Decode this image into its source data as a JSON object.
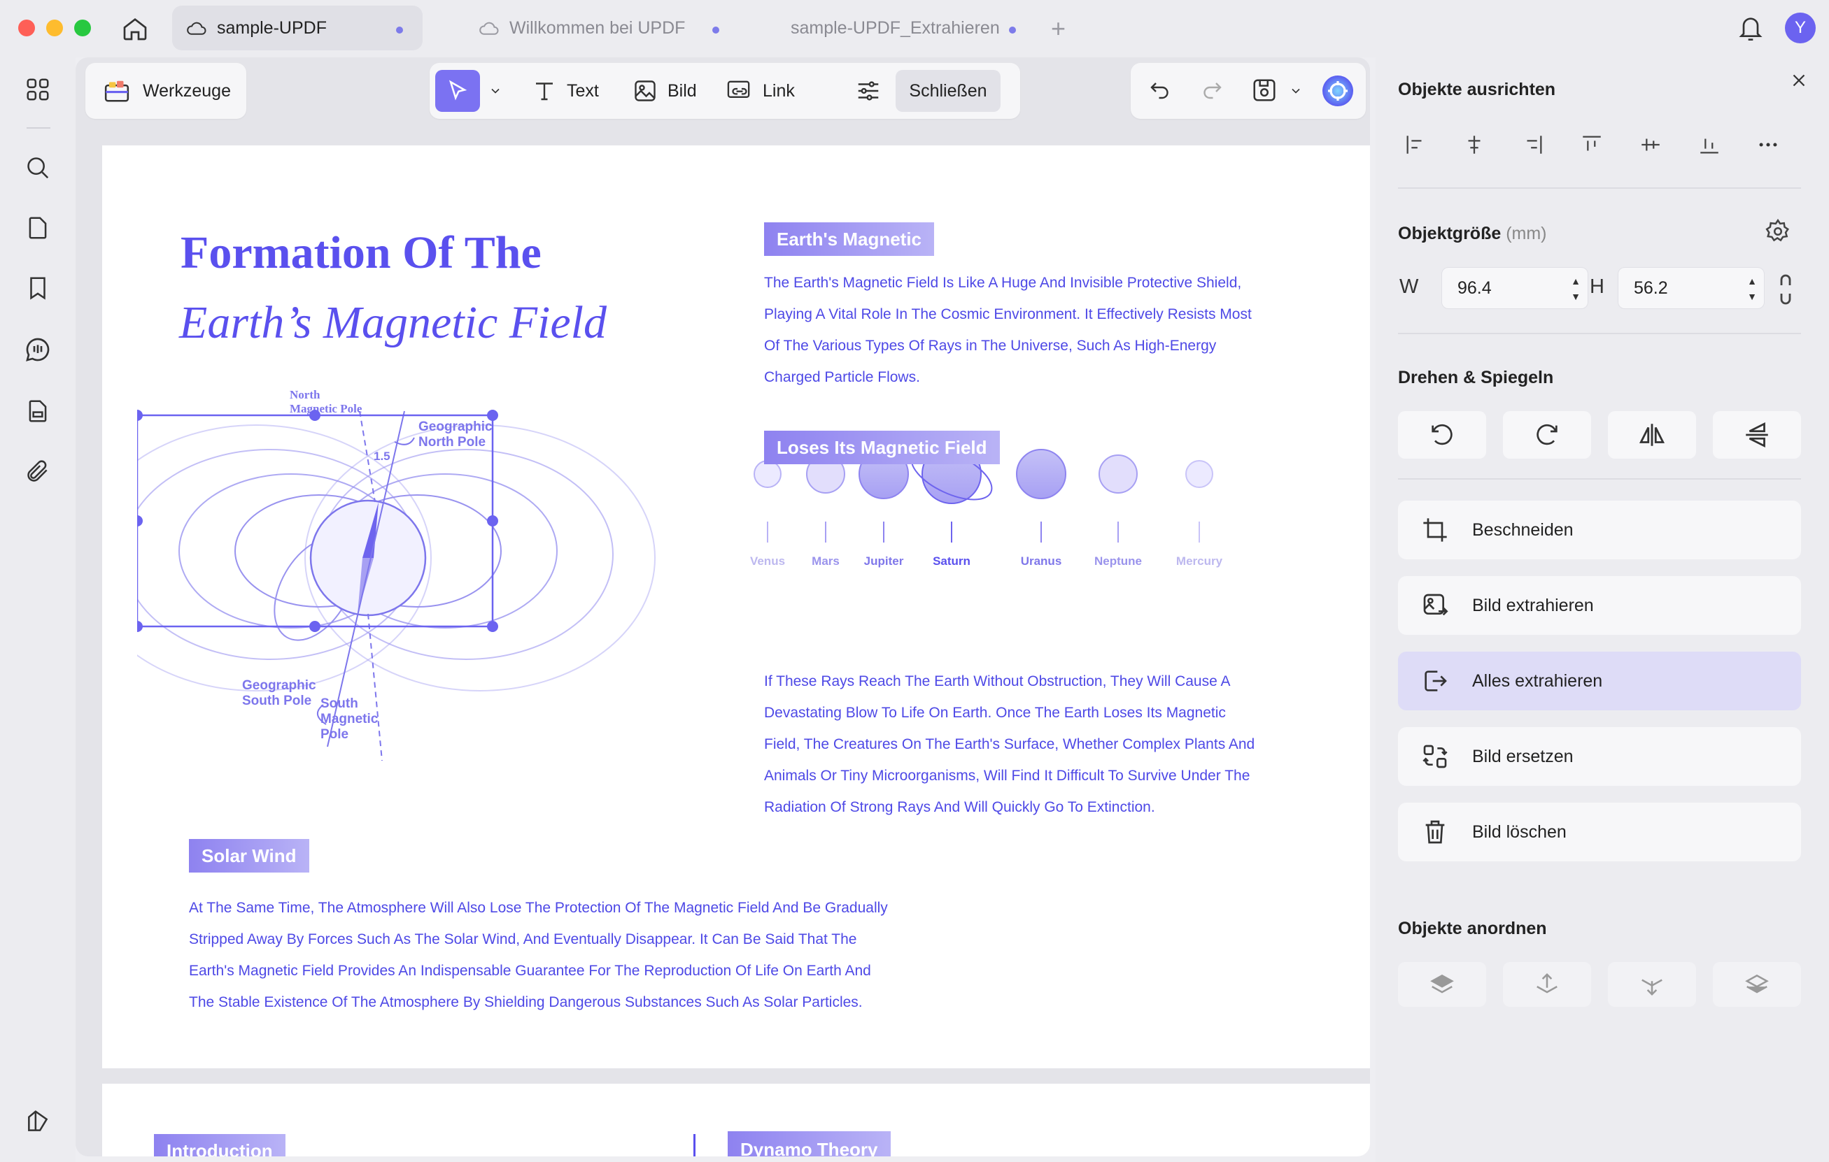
{
  "tabs": [
    {
      "label": "sample-UPDF",
      "active": true
    },
    {
      "label": "Willkommen bei UPDF",
      "active": false
    },
    {
      "label": "sample-UPDF_Extrahieren",
      "active": false
    }
  ],
  "user": {
    "avatar_letter": "Y"
  },
  "toolbar": {
    "tools_label": "Werkzeuge",
    "text_label": "Text",
    "image_label": "Bild",
    "link_label": "Link",
    "close_label": "Schließen"
  },
  "document": {
    "title_line1": "Formation Of The",
    "title_line2": "Earth’s Magnetic Field",
    "section1": {
      "heading": "Earth's Magnetic",
      "lines": [
        "The Earth's Magnetic Field Is Like A Huge And Invisible Protective Shield,",
        "Playing A Vital Role In The Cosmic Environment. It Effectively Resists Most",
        "Of The Various Types Of Rays in The Universe, Such As High-Energy",
        "Charged Particle Flows."
      ]
    },
    "planets": [
      "Venus",
      "Mars",
      "Jupiter",
      "Saturn",
      "Uranus",
      "Neptune",
      "Mercury"
    ],
    "figure_labels": {
      "north_magnetic_pole_1": "North",
      "north_magnetic_pole_2": "Magnetic Pole",
      "geographic_north_1": "Geographic",
      "geographic_north_2": "North Pole",
      "tilt": "1.5",
      "geographic_south_1": "Geographic",
      "geographic_south_2": "South Pole",
      "south_magnetic_1": "South",
      "south_magnetic_2": "Magnetic",
      "south_magnetic_3": "Pole"
    },
    "section2": {
      "heading": "Loses Its Magnetic Field",
      "lines": [
        "If These Rays Reach The Earth Without Obstruction, They Will Cause A",
        "Devastating Blow To Life On Earth. Once The Earth Loses Its Magnetic",
        "Field, The Creatures On The Earth's Surface, Whether Complex Plants And",
        "Animals Or Tiny Microorganisms, Will Find It Difficult To Survive Under The",
        "Radiation Of Strong Rays And Will Quickly Go To Extinction."
      ]
    },
    "section3": {
      "heading": "Solar Wind",
      "lines": [
        "At The Same Time, The Atmosphere Will Also Lose The Protection Of The Magnetic Field And Be Gradually",
        "Stripped Away By Forces Such As The Solar Wind, And Eventually Disappear. It Can Be Said That The",
        "Earth's Magnetic Field Provides An Indispensable Guarantee For The Reproduction Of Life On Earth And",
        "The Stable Existence Of The Atmosphere By Shielding Dangerous Substances Such As Solar Particles."
      ]
    },
    "page2_heading_left": "Introduction",
    "page2_heading_right": "Dynamo Theory"
  },
  "panel": {
    "align_title": "Objekte ausrichten",
    "size_title": "Objektgröße",
    "size_unit": "(mm)",
    "width_label": "W",
    "width_value": "96.4",
    "height_label": "H",
    "height_value": "56.2",
    "rotate_title": "Drehen & Spiegeln",
    "actions": {
      "crop": "Beschneiden",
      "extract_image": "Bild extrahieren",
      "extract_all": "Alles extrahieren",
      "replace_image": "Bild ersetzen",
      "delete_image": "Bild löschen"
    },
    "arrange_title": "Objekte anordnen"
  },
  "colors": {
    "accent": "#7b72f2",
    "doc_text": "#4e49e6",
    "heading": "#5a50ee"
  }
}
